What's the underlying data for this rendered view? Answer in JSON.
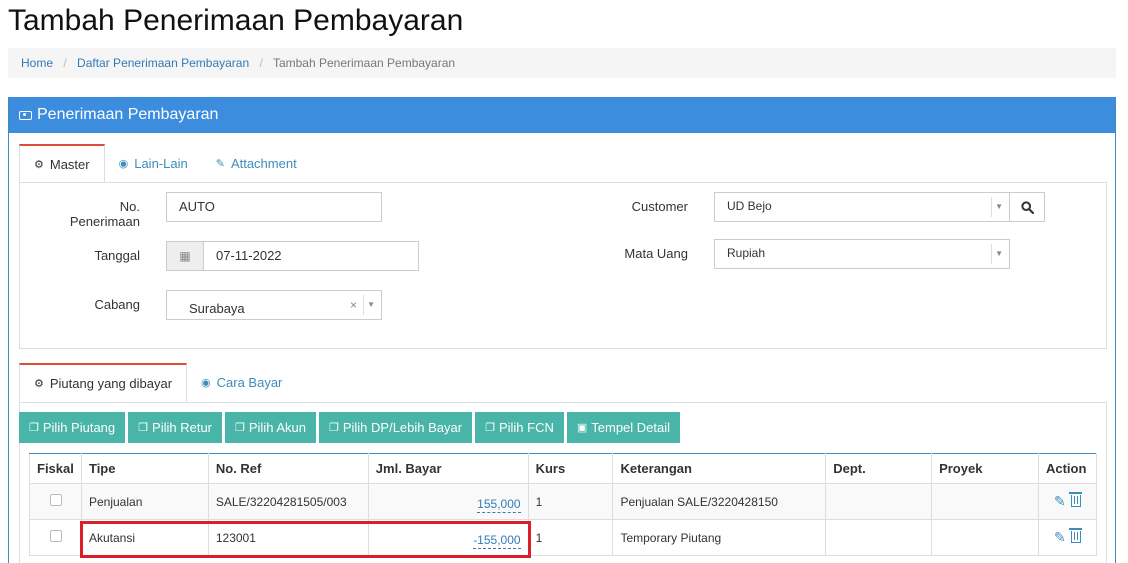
{
  "page": {
    "title": "Tambah Penerimaan Pembayaran"
  },
  "breadcrumb": {
    "home": "Home",
    "list": "Daftar Penerimaan Pembayaran",
    "current": "Tambah Penerimaan Pembayaran",
    "separator": "/"
  },
  "panel": {
    "title": "Penerimaan Pembayaran"
  },
  "tabs_top": [
    {
      "label": "Master",
      "icon": "gears-icon",
      "active": true
    },
    {
      "label": "Lain-Lain",
      "icon": "check-circle-icon",
      "active": false
    },
    {
      "label": "Attachment",
      "icon": "paperclip-icon",
      "active": false
    }
  ],
  "form": {
    "no_penerimaan": {
      "label": "No. Penerimaan",
      "value": "AUTO"
    },
    "tanggal": {
      "label": "Tanggal",
      "value": "07-11-2022"
    },
    "cabang": {
      "label": "Cabang",
      "value": "Surabaya"
    },
    "customer": {
      "label": "Customer",
      "value": "UD Bejo"
    },
    "mata_uang": {
      "label": "Mata Uang",
      "value": "Rupiah"
    }
  },
  "tabs_detail": [
    {
      "label": "Piutang yang dibayar",
      "icon": "gears-icon",
      "active": true
    },
    {
      "label": "Cara Bayar",
      "icon": "check-circle-icon",
      "active": false
    }
  ],
  "buttons": [
    {
      "label": "Pilih Piutang"
    },
    {
      "label": "Pilih Retur"
    },
    {
      "label": "Pilih Akun"
    },
    {
      "label": "Pilih DP/Lebih Bayar"
    },
    {
      "label": "Pilih FCN"
    },
    {
      "label": "Tempel Detail"
    }
  ],
  "table": {
    "headers": [
      "Fiskal",
      "Tipe",
      "No. Ref",
      "Jml. Bayar",
      "Kurs",
      "Keterangan",
      "Dept.",
      "Proyek",
      "Action"
    ],
    "rows": [
      {
        "tipe": "Penjualan",
        "no_ref": "SALE/32204281505/003",
        "jml_bayar": "155,000",
        "kurs": "1",
        "keterangan": "Penjualan SALE/3220428150",
        "dept": "",
        "proyek": ""
      },
      {
        "tipe": "Akutansi",
        "no_ref": "123001",
        "jml_bayar": "-155,000",
        "kurs": "1",
        "keterangan": "Temporary Piutang",
        "dept": "",
        "proyek": ""
      }
    ]
  },
  "colors": {
    "primary": "#3c8dde",
    "teal": "#48b5a8",
    "link": "#337ab7",
    "highlight": "#d9202a"
  }
}
